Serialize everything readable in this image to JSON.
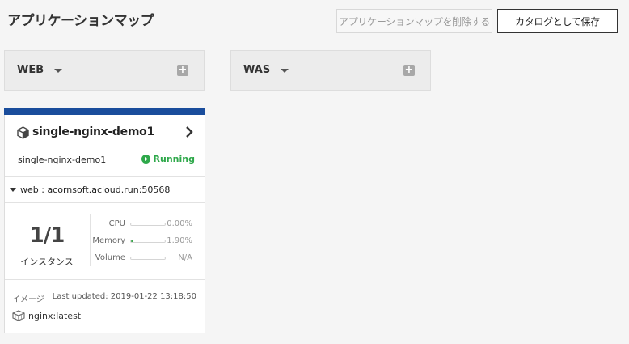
{
  "header": {
    "title": "アプリケーションマップ",
    "delete_label": "アプリケーションマップを削除する",
    "save_label": "カタログとして保存"
  },
  "groups": [
    {
      "label": "WEB"
    },
    {
      "label": "WAS"
    }
  ],
  "card": {
    "name": "single-nginx-demo1",
    "sub_name": "single-nginx-demo1",
    "status": "Running",
    "endpoint": "web : acornsoft.acloud.run:50568",
    "instances": "1/1",
    "instances_label": "インスタンス",
    "metrics": [
      {
        "label": "CPU",
        "value": "0.00%",
        "fraction": 0.0
      },
      {
        "label": "Memory",
        "value": "1.90%",
        "fraction": 0.019
      },
      {
        "label": "Volume",
        "value": "N/A",
        "fraction": 0.0
      }
    ],
    "image_label": "イメージ",
    "last_updated": "Last updated: 2019-01-22 13:18:50",
    "image": "nginx:latest"
  },
  "colors": {
    "accent": "#1a4d9c",
    "running": "#2ea84a"
  },
  "icons": {
    "add": "plus-square-icon",
    "app": "cube-icon",
    "navigate": "chevron-right-icon",
    "status": "play-circle-icon",
    "image": "container-icon"
  }
}
